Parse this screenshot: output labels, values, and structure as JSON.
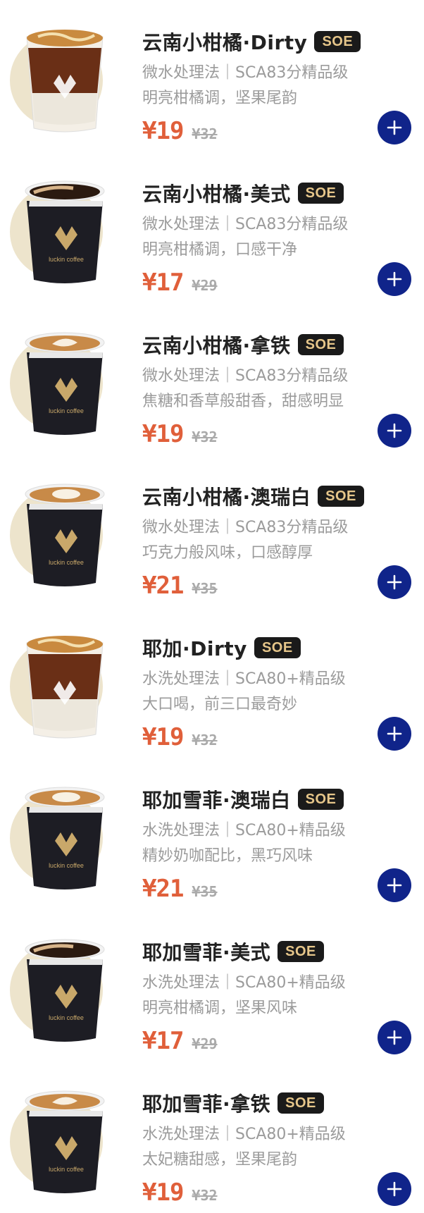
{
  "products": [
    {
      "name": "云南小柑橘·Dirty",
      "badge": "SOE",
      "desc1": "微水处理法｜SCA83分精品级",
      "desc2": "明亮柑橘调，坚果尾韵",
      "price": "¥19",
      "orig_price": "¥32",
      "thumb": "dirty-coffee",
      "image_label": "luckin coffee"
    },
    {
      "name": "云南小柑橘·美式",
      "badge": "SOE",
      "desc1": "微水处理法｜SCA83分精品级",
      "desc2": "明亮柑橘调，口感干净",
      "price": "¥17",
      "orig_price": "¥29",
      "thumb": "americano-cup",
      "image_label": "luckin coffee"
    },
    {
      "name": "云南小柑橘·拿铁",
      "badge": "SOE",
      "desc1": "微水处理法｜SCA83分精品级",
      "desc2": "焦糖和香草般甜香，甜感明显",
      "price": "¥19",
      "orig_price": "¥32",
      "thumb": "latte-swan-cup",
      "image_label": "luckin coffee"
    },
    {
      "name": "云南小柑橘·澳瑞白",
      "badge": "SOE",
      "desc1": "微水处理法｜SCA83分精品级",
      "desc2": "巧克力般风味，口感醇厚",
      "price": "¥21",
      "orig_price": "¥35",
      "thumb": "flat-white-cup",
      "image_label": "luckin coffee"
    },
    {
      "name": "耶加·Dirty",
      "badge": "SOE",
      "desc1": "水洗处理法｜SCA80+精品级",
      "desc2": "大口喝，前三口最奇妙",
      "price": "¥19",
      "orig_price": "¥32",
      "thumb": "dirty-coffee",
      "image_label": "luckin coffee"
    },
    {
      "name": "耶加雪菲·澳瑞白",
      "badge": "SOE",
      "desc1": "水洗处理法｜SCA80+精品级",
      "desc2": "精妙奶咖配比，黑巧风味",
      "price": "¥21",
      "orig_price": "¥35",
      "thumb": "flat-white-cup",
      "image_label": "luckin coffee"
    },
    {
      "name": "耶加雪菲·美式",
      "badge": "SOE",
      "desc1": "水洗处理法｜SCA80+精品级",
      "desc2": "明亮柑橘调，坚果风味",
      "price": "¥17",
      "orig_price": "¥29",
      "thumb": "americano-cup",
      "image_label": "luckin coffee"
    },
    {
      "name": "耶加雪菲·拿铁",
      "badge": "SOE",
      "desc1": "水洗处理法｜SCA80+精品级",
      "desc2": "太妃糖甜感，坚果尾韵",
      "price": "¥19",
      "orig_price": "¥32",
      "thumb": "latte-art-cup",
      "image_label": "luckin coffee"
    }
  ],
  "colors": {
    "price": "#e05f3a",
    "add_button": "#10248a",
    "badge_bg": "#1a1a1a",
    "badge_text": "#e6c68a",
    "thumb_circle": "#ede4cc"
  },
  "icons": {
    "add": "plus-icon"
  }
}
